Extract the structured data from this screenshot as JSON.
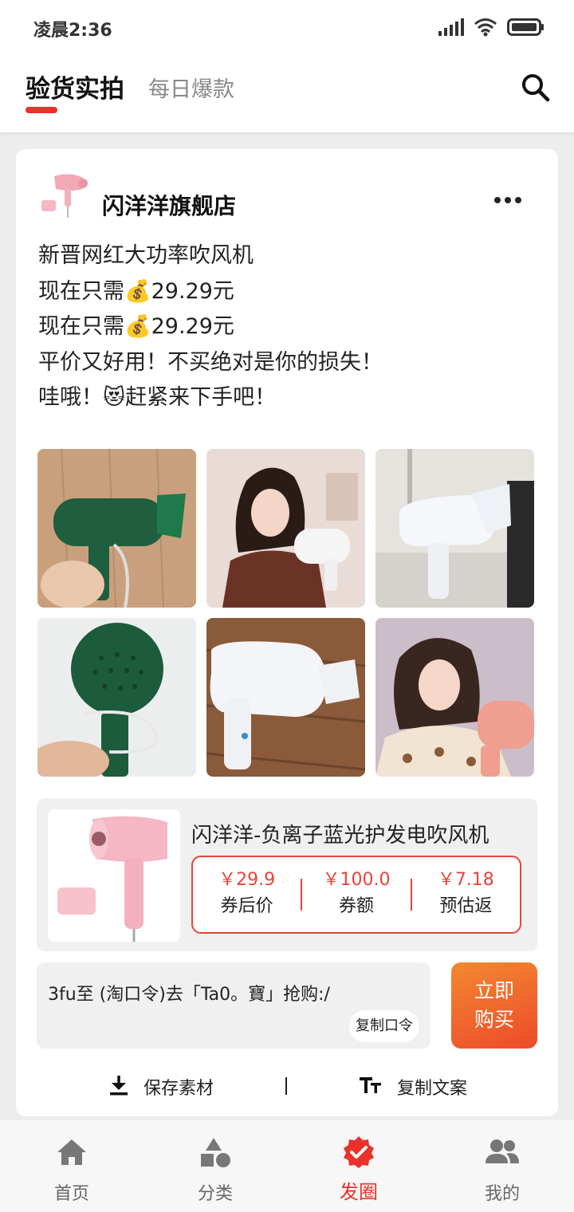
{
  "status_bar": {
    "time": "凌晨2:36"
  },
  "header": {
    "active_tab": "验货实拍",
    "inactive_tab": "每日爆款",
    "search_icon": "search-icon",
    "accent_color": "#e8322b"
  },
  "post": {
    "shop_name": "闪洋洋旗舰店",
    "lines": [
      "新晋网红大功率吹风机",
      "现在只需💰29.29元",
      "现在只需💰29.29元",
      "平价又好用！不买绝对是你的损失！",
      "哇哦！😻赶紧来下手吧！"
    ]
  },
  "product": {
    "title": "闪洋洋-负离子蓝光护发电吹风机",
    "after_coupon_price": "￥29.9",
    "after_coupon_label": "券后价",
    "coupon_amount": "￥100.0",
    "coupon_label": "券额",
    "rebate": "￥7.18",
    "rebate_label": "预估返"
  },
  "command": {
    "text": "3fu至 (淘口令)去「Ta0。寶」抢购:/",
    "copy_label": "复制口令",
    "buy_line1": "立即",
    "buy_line2": "购买"
  },
  "actions": {
    "save_label": "保存素材",
    "copy_text_label": "复制文案"
  },
  "bottom_nav": {
    "items": [
      {
        "label": "首页",
        "icon": "home-icon"
      },
      {
        "label": "分类",
        "icon": "category-icon"
      },
      {
        "label": "发圈",
        "icon": "badge-check-icon"
      },
      {
        "label": "我的",
        "icon": "people-icon"
      }
    ],
    "active_index": 2
  }
}
